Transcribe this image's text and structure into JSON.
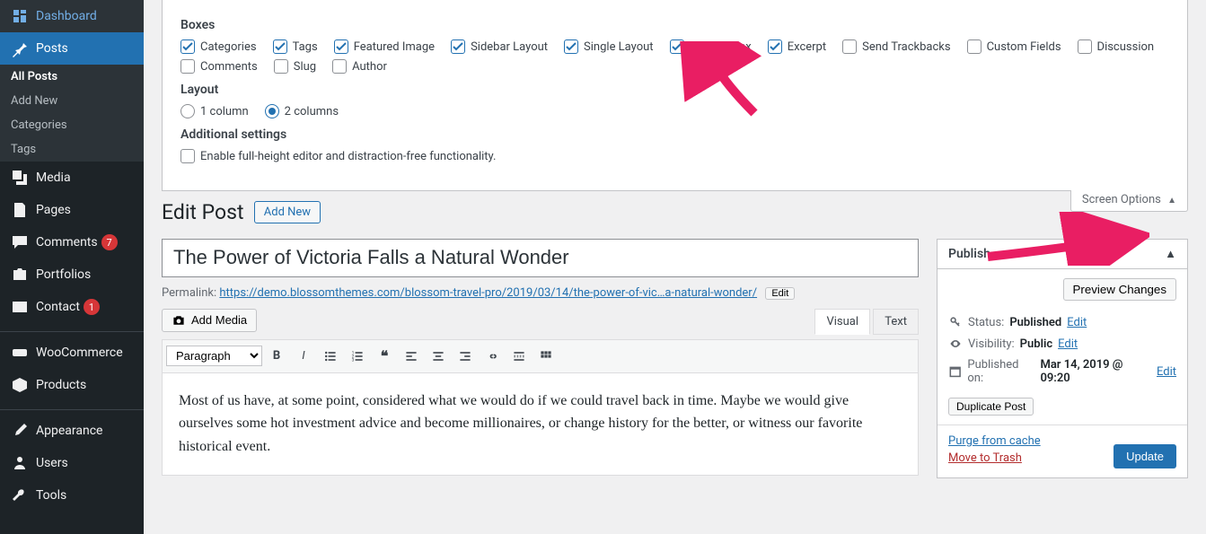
{
  "sidebar": {
    "dashboard": "Dashboard",
    "posts": "Posts",
    "posts_sub": {
      "all": "All Posts",
      "add": "Add New",
      "cats": "Categories",
      "tags": "Tags"
    },
    "media": "Media",
    "pages": "Pages",
    "comments": "Comments",
    "comments_count": "7",
    "portfolios": "Portfolios",
    "contact": "Contact",
    "contact_count": "1",
    "woo": "WooCommerce",
    "products": "Products",
    "appearance": "Appearance",
    "users": "Users",
    "tools": "Tools"
  },
  "screen_options": {
    "tab_label": "Screen Options",
    "boxes_heading": "Boxes",
    "boxes": [
      {
        "label": "Categories",
        "checked": true
      },
      {
        "label": "Tags",
        "checked": true
      },
      {
        "label": "Featured Image",
        "checked": true
      },
      {
        "label": "Sidebar Layout",
        "checked": true
      },
      {
        "label": "Single Layout",
        "checked": true
      },
      {
        "label": "Affiliate Box",
        "checked": true
      },
      {
        "label": "Excerpt",
        "checked": true
      },
      {
        "label": "Send Trackbacks",
        "checked": false
      },
      {
        "label": "Custom Fields",
        "checked": false
      },
      {
        "label": "Discussion",
        "checked": false
      },
      {
        "label": "Comments",
        "checked": false
      },
      {
        "label": "Slug",
        "checked": false
      },
      {
        "label": "Author",
        "checked": false
      }
    ],
    "layout_heading": "Layout",
    "layout": {
      "col1": "1 column",
      "col2": "2 columns",
      "selected": "col2"
    },
    "additional_heading": "Additional settings",
    "fullheight": {
      "label": "Enable full-height editor and distraction-free functionality.",
      "checked": false
    }
  },
  "editor": {
    "page_title": "Edit Post",
    "add_new": "Add New",
    "post_title": "The Power of Victoria Falls a Natural Wonder",
    "permalink_label": "Permalink:",
    "permalink_url": "https://demo.blossomthemes.com/blossom-travel-pro/2019/03/14/the-power-of-vic…a-natural-wonder/",
    "edit_slug": "Edit",
    "add_media": "Add Media",
    "tab_visual": "Visual",
    "tab_text": "Text",
    "format_select": "Paragraph",
    "content": "Most of us have, at some point, considered what we would do if we could travel back in time. Maybe we would give ourselves some hot investment advice and become millionaires, or change history for the better, or witness our favorite historical event."
  },
  "publish": {
    "heading": "Publish",
    "preview": "Preview Changes",
    "status_label": "Status:",
    "status_value": "Published",
    "visibility_label": "Visibility:",
    "visibility_value": "Public",
    "published_label": "Published on:",
    "published_value": "Mar 14, 2019 @ 09:20",
    "edit": "Edit",
    "duplicate": "Duplicate Post",
    "purge": "Purge from cache",
    "trash": "Move to Trash",
    "update": "Update"
  }
}
